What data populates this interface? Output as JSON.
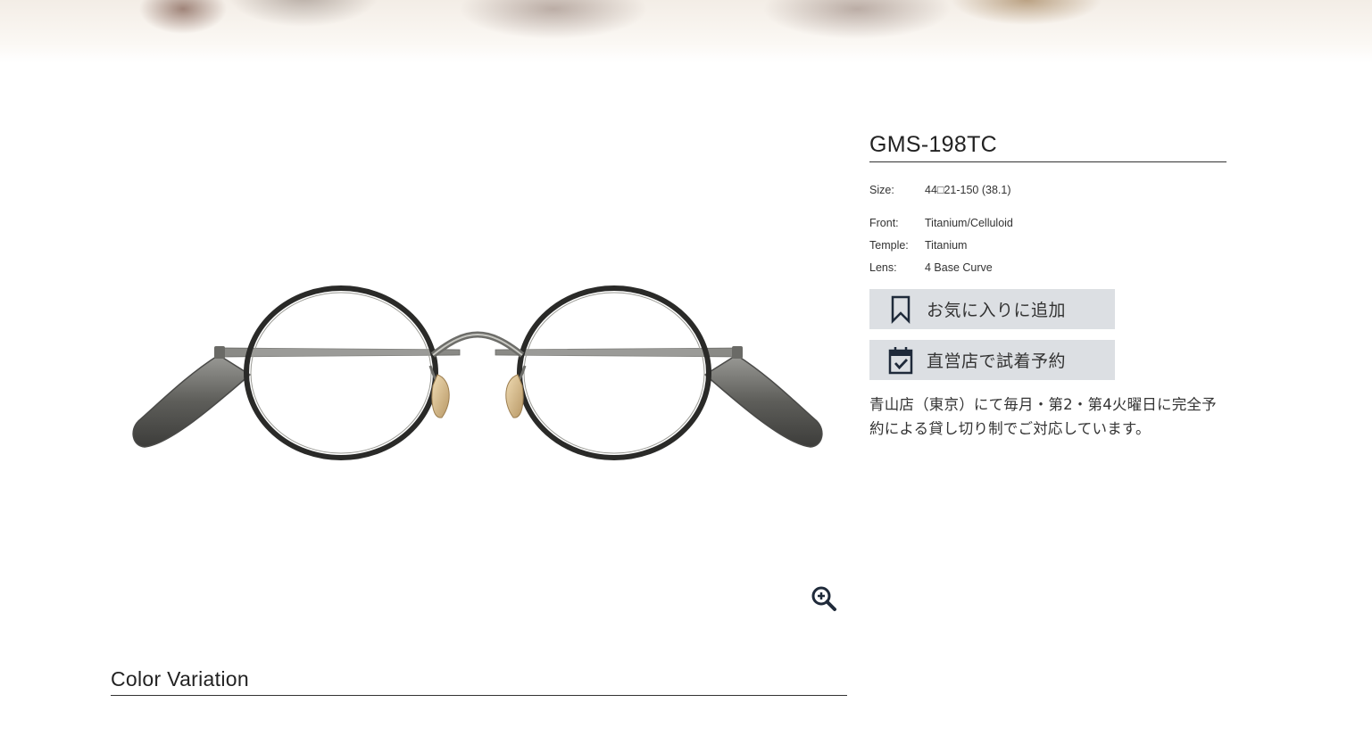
{
  "product": {
    "model": "GMS-198TC",
    "image_alt": "glasses-product-photo",
    "specs": [
      {
        "label": "Size:",
        "value": "44□21-150 (38.1)"
      },
      {
        "label": "Front:",
        "value": "Titanium/Celluloid"
      },
      {
        "label": "Temple:",
        "value": "Titanium"
      },
      {
        "label": "Lens:",
        "value": "4 Base Curve"
      }
    ]
  },
  "actions": {
    "favorite_label": "お気に入りに追加",
    "favorite_icon": "bookmark-icon",
    "reserve_label": "直営店で試着予約",
    "reserve_icon": "calendar-check-icon"
  },
  "note": "青山店（東京）にて毎月・第2・第4火曜日に完全予約による貸し切り制でご対応しています。",
  "section": {
    "color_variation_title": "Color Variation"
  },
  "icons": {
    "zoom": "zoom-in-icon"
  },
  "colors": {
    "button_bg": "#dcdfe3",
    "icon_color": "#1f2a3a",
    "frame_color": "#2a2a28"
  }
}
